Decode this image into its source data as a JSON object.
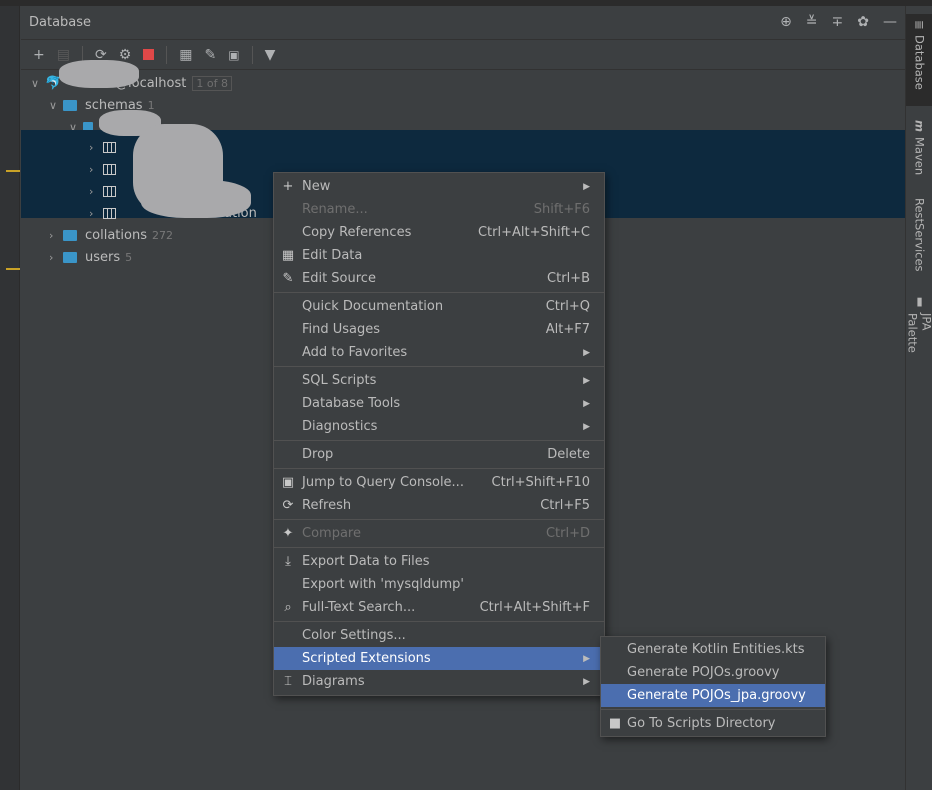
{
  "panel": {
    "title": "Database",
    "header_icons": [
      "locate-icon",
      "expand-all-icon",
      "collapse-all-icon",
      "gear-icon",
      "minimize-icon"
    ]
  },
  "toolbar": {
    "icons": [
      "add-icon",
      "duplicate-icon",
      "refresh-icon",
      "data-source-properties-icon",
      "stop-icon",
      "table-icon",
      "edit-icon",
      "query-console-icon",
      "filter-icon"
    ],
    "stop_color": "#e04848"
  },
  "tree": {
    "host": "@localhost",
    "host_badge": "1 of 8",
    "schemas": "schemas",
    "schemas_count": "1",
    "table4_suffix": "ation",
    "collations": "collations",
    "collations_count": "272",
    "users": "users",
    "users_count": "5"
  },
  "sidebar": {
    "tabs": [
      "Database",
      "Maven",
      "RestServices",
      "JPA Palette"
    ]
  },
  "menu": {
    "items": [
      {
        "label": "New",
        "icon": "+",
        "icon_name": "plus-icon",
        "submenu": true
      },
      {
        "label": "Rename...",
        "shortcut": "Shift+F6",
        "disabled": true
      },
      {
        "label": "Copy References",
        "shortcut": "Ctrl+Alt+Shift+C"
      },
      {
        "label": "Edit Data",
        "icon": "▦",
        "icon_name": "table-icon"
      },
      {
        "label": "Edit Source",
        "icon": "✎",
        "icon_name": "edit-icon",
        "shortcut": "Ctrl+B"
      },
      {
        "sep": true
      },
      {
        "label": "Quick Documentation",
        "shortcut": "Ctrl+Q"
      },
      {
        "label": "Find Usages",
        "shortcut": "Alt+F7"
      },
      {
        "label": "Add to Favorites",
        "submenu": true
      },
      {
        "sep": true
      },
      {
        "label": "SQL Scripts",
        "submenu": true
      },
      {
        "label": "Database Tools",
        "submenu": true
      },
      {
        "label": "Diagnostics",
        "submenu": true
      },
      {
        "sep": true
      },
      {
        "label": "Drop",
        "shortcut": "Delete"
      },
      {
        "sep": true
      },
      {
        "label": "Jump to Query Console...",
        "icon": "▣",
        "icon_name": "query-console-icon",
        "shortcut": "Ctrl+Shift+F10"
      },
      {
        "label": "Refresh",
        "icon": "⟳",
        "icon_name": "refresh-icon",
        "shortcut": "Ctrl+F5"
      },
      {
        "sep": true
      },
      {
        "label": "Compare",
        "icon": "✦",
        "icon_name": "compare-icon",
        "shortcut": "Ctrl+D",
        "disabled": true
      },
      {
        "sep": true
      },
      {
        "label": "Export Data to Files",
        "icon": "⤓",
        "icon_name": "export-icon"
      },
      {
        "label": "Export with 'mysqldump'"
      },
      {
        "label": "Full-Text Search...",
        "icon": "⌕",
        "icon_name": "search-icon",
        "shortcut": "Ctrl+Alt+Shift+F"
      },
      {
        "sep": true
      },
      {
        "label": "Color Settings..."
      },
      {
        "label": "Scripted Extensions",
        "submenu": true,
        "highlight": true
      },
      {
        "label": "Diagrams",
        "icon": "⌶",
        "icon_name": "diagram-icon",
        "submenu": true
      }
    ]
  },
  "submenu": {
    "items": [
      {
        "label": "Generate Kotlin Entities.kts"
      },
      {
        "label": "Generate POJOs.groovy"
      },
      {
        "label": "Generate POJOs_jpa.groovy",
        "highlight": true
      },
      {
        "sep": true
      },
      {
        "label": "Go To Scripts Directory",
        "icon": "■",
        "icon_name": "folder-icon"
      }
    ]
  },
  "colors": {
    "selection": "#0d293e",
    "menu_highlight": "#4b6eaf",
    "folder": "#3a95c8"
  }
}
